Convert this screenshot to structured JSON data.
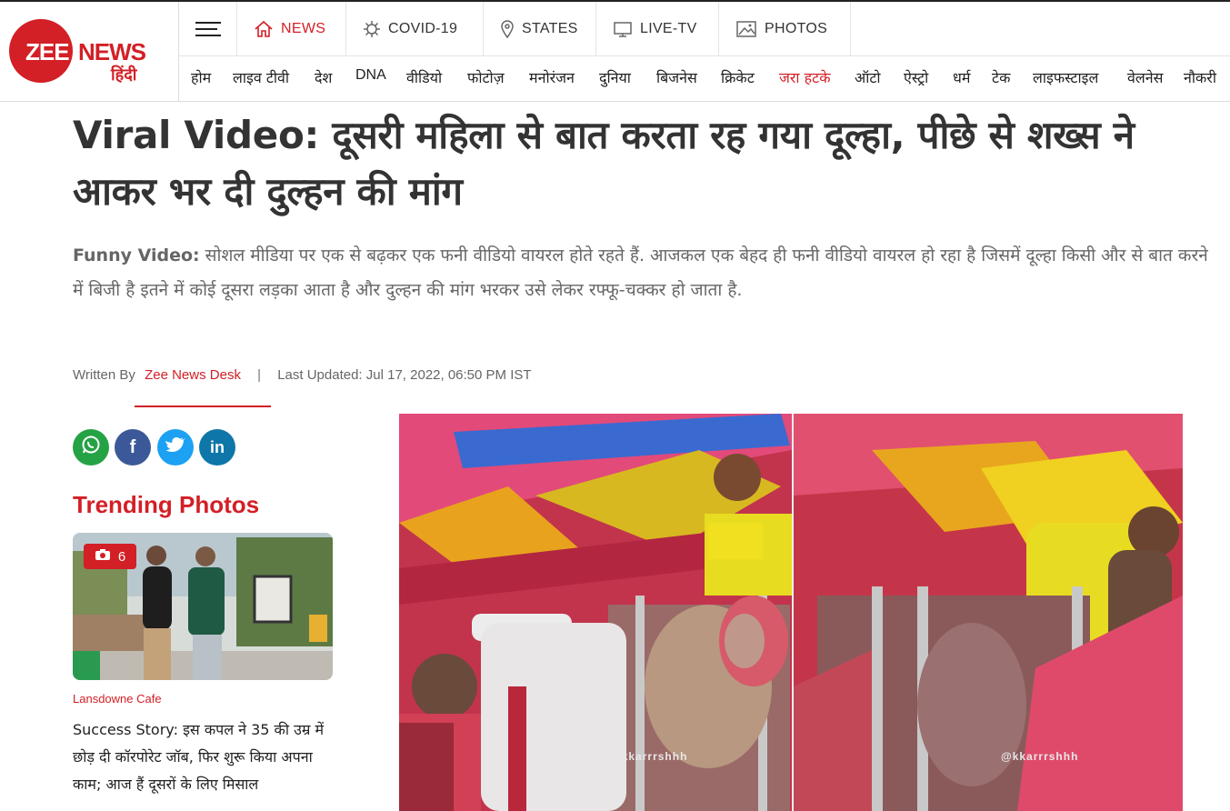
{
  "brand": {
    "logo_en": "ZEE",
    "logo_news": "NEWS",
    "logo_hi": "हिंदी",
    "accent": "#d31f26"
  },
  "main_nav": [
    {
      "label": "NEWS",
      "icon": "home-icon",
      "active": true
    },
    {
      "label": "COVID-19",
      "icon": "virus-icon",
      "active": false
    },
    {
      "label": "STATES",
      "icon": "map-pin-icon",
      "active": false
    },
    {
      "label": "LIVE-TV",
      "icon": "tv-icon",
      "active": false
    },
    {
      "label": "PHOTOS",
      "icon": "photo-icon",
      "active": false
    }
  ],
  "sub_nav": [
    "होम",
    "लाइव टीवी",
    "देश",
    "DNA",
    "वीडियो",
    "फोटोज़",
    "मनोरंजन",
    "दुनिया",
    "बिजनेस",
    "क्रिकेट",
    "जरा हटके",
    "ऑटो",
    "ऐस्ट्रो",
    "धर्म",
    "टेक",
    "लाइफस्टाइल",
    "वेलनेस",
    "नौकरी"
  ],
  "article": {
    "headline": "Viral Video: दूसरी महिला से बात करता रह गया दूल्हा, पीछे से शख्स ने आकर भर दी दुल्हन की मांग",
    "summary_lead": "Funny Video:",
    "summary_text": " सोशल मीडिया पर एक से बढ़कर एक फनी वीडियो वायरल होते रहते हैं. आजकल एक बेहद ही फनी वीडियो वायरल हो रहा है जिसमें दूल्हा किसी और से बात करने में बिजी है इतने में कोई दूसरा लड़का आता है और दुल्हन की मांग भरकर उसे लेकर रफ्फू-चक्कर हो जाता है.",
    "written_by_label": "Written By",
    "author": "Zee News Desk",
    "separator": "|",
    "updated": "Last Updated: Jul 17, 2022, 06:50 PM IST",
    "watermark": "@kkarrrshhh"
  },
  "share": [
    {
      "name": "whatsapp",
      "glyph": "✆",
      "color": "#25a244"
    },
    {
      "name": "facebook",
      "glyph": "f",
      "color": "#3b5998"
    },
    {
      "name": "twitter",
      "glyph": "t",
      "color": "#1da1f2"
    },
    {
      "name": "linkedin",
      "glyph": "in",
      "color": "#0e76a8"
    }
  ],
  "trending": {
    "title": "Trending Photos",
    "badge_count": "6",
    "tag": "Lansdowne Cafe",
    "text": "Success Story: इस कपल ने 35 की उम्र में छोड़ दी कॉरपोरेट जॉब, फिर शुरू किया अपना काम; आज हैं दूसरों के लिए मिसाल"
  }
}
